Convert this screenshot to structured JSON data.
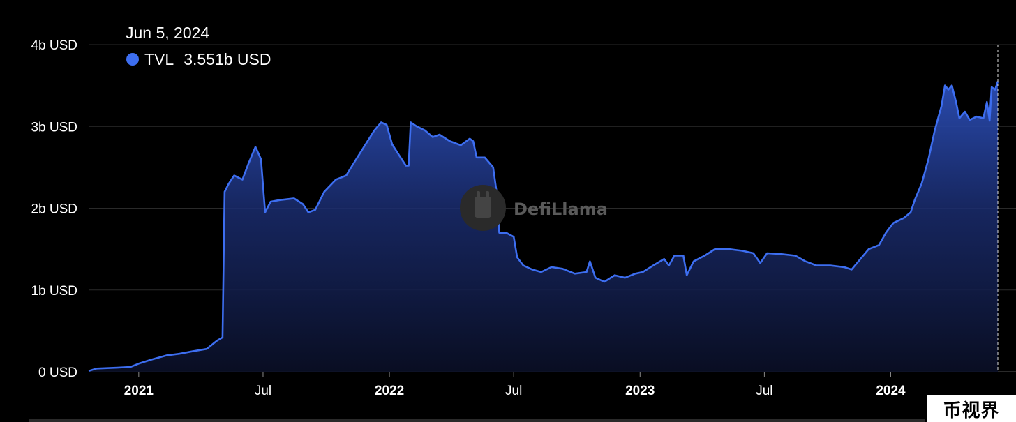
{
  "chart_data": {
    "type": "area",
    "title": "",
    "xlabel": "",
    "ylabel": "",
    "ylim": [
      0,
      4000000000
    ],
    "yticks": [
      {
        "value": 0,
        "label": "0 USD"
      },
      {
        "value": 1000000000,
        "label": "1b USD"
      },
      {
        "value": 2000000000,
        "label": "2b USD"
      },
      {
        "value": 3000000000,
        "label": "3b USD"
      },
      {
        "value": 4000000000,
        "label": "4b USD"
      }
    ],
    "xlim": [
      "2020-10-20",
      "2024-06-05"
    ],
    "xticks": [
      {
        "date": "2021-01-01",
        "label": "2021",
        "bold": true
      },
      {
        "date": "2021-07-01",
        "label": "Jul",
        "bold": false
      },
      {
        "date": "2022-01-01",
        "label": "2022",
        "bold": true
      },
      {
        "date": "2022-07-01",
        "label": "Jul",
        "bold": false
      },
      {
        "date": "2023-01-01",
        "label": "2023",
        "bold": true
      },
      {
        "date": "2023-07-01",
        "label": "Jul",
        "bold": false
      },
      {
        "date": "2024-01-01",
        "label": "2024",
        "bold": true
      }
    ],
    "grid": true,
    "series": [
      {
        "name": "TVL",
        "color": "#3d6ef0",
        "points": [
          [
            "2020-10-20",
            0.01
          ],
          [
            "2020-11-01",
            0.04
          ],
          [
            "2020-12-01",
            0.05
          ],
          [
            "2020-12-20",
            0.06
          ],
          [
            "2021-01-01",
            0.1
          ],
          [
            "2021-01-20",
            0.15
          ],
          [
            "2021-02-10",
            0.2
          ],
          [
            "2021-03-01",
            0.22
          ],
          [
            "2021-03-20",
            0.25
          ],
          [
            "2021-04-10",
            0.28
          ],
          [
            "2021-04-25",
            0.38
          ],
          [
            "2021-05-03",
            0.42
          ],
          [
            "2021-05-06",
            2.2
          ],
          [
            "2021-05-12",
            2.3
          ],
          [
            "2021-05-20",
            2.4
          ],
          [
            "2021-06-01",
            2.35
          ],
          [
            "2021-06-10",
            2.55
          ],
          [
            "2021-06-20",
            2.75
          ],
          [
            "2021-06-28",
            2.6
          ],
          [
            "2021-07-04",
            1.95
          ],
          [
            "2021-07-12",
            2.08
          ],
          [
            "2021-07-25",
            2.1
          ],
          [
            "2021-08-15",
            2.12
          ],
          [
            "2021-08-28",
            2.05
          ],
          [
            "2021-09-05",
            1.95
          ],
          [
            "2021-09-15",
            1.98
          ],
          [
            "2021-09-28",
            2.2
          ],
          [
            "2021-10-15",
            2.35
          ],
          [
            "2021-10-30",
            2.4
          ],
          [
            "2021-11-10",
            2.55
          ],
          [
            "2021-11-25",
            2.75
          ],
          [
            "2021-12-10",
            2.95
          ],
          [
            "2021-12-20",
            3.05
          ],
          [
            "2021-12-28",
            3.02
          ],
          [
            "2022-01-05",
            2.78
          ],
          [
            "2022-01-15",
            2.65
          ],
          [
            "2022-01-25",
            2.52
          ],
          [
            "2022-01-29",
            2.52
          ],
          [
            "2022-02-01",
            3.05
          ],
          [
            "2022-02-10",
            3.0
          ],
          [
            "2022-02-22",
            2.95
          ],
          [
            "2022-03-05",
            2.87
          ],
          [
            "2022-03-15",
            2.9
          ],
          [
            "2022-03-30",
            2.82
          ],
          [
            "2022-04-15",
            2.77
          ],
          [
            "2022-04-28",
            2.85
          ],
          [
            "2022-05-03",
            2.82
          ],
          [
            "2022-05-08",
            2.62
          ],
          [
            "2022-05-20",
            2.62
          ],
          [
            "2022-06-01",
            2.5
          ],
          [
            "2022-06-06",
            2.2
          ],
          [
            "2022-06-10",
            1.7
          ],
          [
            "2022-06-20",
            1.7
          ],
          [
            "2022-07-01",
            1.65
          ],
          [
            "2022-07-06",
            1.4
          ],
          [
            "2022-07-15",
            1.3
          ],
          [
            "2022-07-28",
            1.25
          ],
          [
            "2022-08-10",
            1.22
          ],
          [
            "2022-08-25",
            1.28
          ],
          [
            "2022-09-10",
            1.26
          ],
          [
            "2022-09-28",
            1.2
          ],
          [
            "2022-10-15",
            1.22
          ],
          [
            "2022-10-20",
            1.35
          ],
          [
            "2022-10-28",
            1.15
          ],
          [
            "2022-11-10",
            1.1
          ],
          [
            "2022-11-25",
            1.18
          ],
          [
            "2022-12-10",
            1.15
          ],
          [
            "2022-12-25",
            1.2
          ],
          [
            "2023-01-05",
            1.22
          ],
          [
            "2023-01-20",
            1.3
          ],
          [
            "2023-02-05",
            1.38
          ],
          [
            "2023-02-12",
            1.3
          ],
          [
            "2023-02-20",
            1.42
          ],
          [
            "2023-03-05",
            1.42
          ],
          [
            "2023-03-10",
            1.18
          ],
          [
            "2023-03-20",
            1.35
          ],
          [
            "2023-04-05",
            1.42
          ],
          [
            "2023-04-20",
            1.5
          ],
          [
            "2023-05-10",
            1.5
          ],
          [
            "2023-05-30",
            1.48
          ],
          [
            "2023-06-15",
            1.45
          ],
          [
            "2023-06-25",
            1.33
          ],
          [
            "2023-07-05",
            1.45
          ],
          [
            "2023-07-25",
            1.44
          ],
          [
            "2023-08-15",
            1.42
          ],
          [
            "2023-08-30",
            1.35
          ],
          [
            "2023-09-15",
            1.3
          ],
          [
            "2023-10-05",
            1.3
          ],
          [
            "2023-10-25",
            1.28
          ],
          [
            "2023-11-05",
            1.25
          ],
          [
            "2023-11-15",
            1.35
          ],
          [
            "2023-11-30",
            1.5
          ],
          [
            "2023-12-15",
            1.55
          ],
          [
            "2023-12-25",
            1.7
          ],
          [
            "2024-01-05",
            1.82
          ],
          [
            "2024-01-20",
            1.88
          ],
          [
            "2024-01-30",
            1.95
          ],
          [
            "2024-02-05",
            2.1
          ],
          [
            "2024-02-15",
            2.3
          ],
          [
            "2024-02-25",
            2.6
          ],
          [
            "2024-03-05",
            2.95
          ],
          [
            "2024-03-10",
            3.1
          ],
          [
            "2024-03-15",
            3.25
          ],
          [
            "2024-03-20",
            3.5
          ],
          [
            "2024-03-25",
            3.45
          ],
          [
            "2024-03-30",
            3.5
          ],
          [
            "2024-04-05",
            3.3
          ],
          [
            "2024-04-10",
            3.1
          ],
          [
            "2024-04-18",
            3.18
          ],
          [
            "2024-04-25",
            3.08
          ],
          [
            "2024-05-05",
            3.12
          ],
          [
            "2024-05-15",
            3.1
          ],
          [
            "2024-05-20",
            3.3
          ],
          [
            "2024-05-24",
            3.07
          ],
          [
            "2024-05-27",
            3.48
          ],
          [
            "2024-06-01",
            3.45
          ],
          [
            "2024-06-05",
            3.551
          ]
        ]
      }
    ]
  },
  "tooltip": {
    "date": "Jun 5, 2024",
    "series_name": "TVL",
    "value_text": "3.551b USD",
    "dot_color": "#3d6ef0"
  },
  "watermark": {
    "text": "DefiLlama"
  },
  "stamp": {
    "text": "币视界"
  }
}
